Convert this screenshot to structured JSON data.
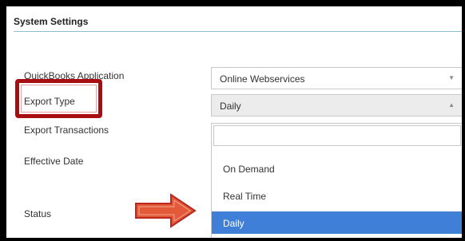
{
  "section": {
    "title": "System Settings"
  },
  "fields": {
    "quickbooks_application": {
      "label": "QuickBooks Application",
      "value": "Online Webservices"
    },
    "export_type": {
      "label": "Export Type",
      "value": "Daily"
    },
    "export_transactions": {
      "label": "Export Transactions"
    },
    "effective_date": {
      "label": "Effective Date"
    },
    "status": {
      "label": "Status"
    }
  },
  "dropdown": {
    "search_value": "",
    "options": [
      {
        "label": "On Demand",
        "selected": false
      },
      {
        "label": "Real Time",
        "selected": false
      },
      {
        "label": "Daily",
        "selected": true
      }
    ]
  },
  "colors": {
    "highlight_border": "#a80d12",
    "arrow_fill": "#e25a3a",
    "selected_option": "#3f7fd8"
  },
  "icons": {
    "closed_select": "chevron-down-icon",
    "open_select": "chevron-up-icon",
    "annotation": "right-arrow-icon"
  }
}
